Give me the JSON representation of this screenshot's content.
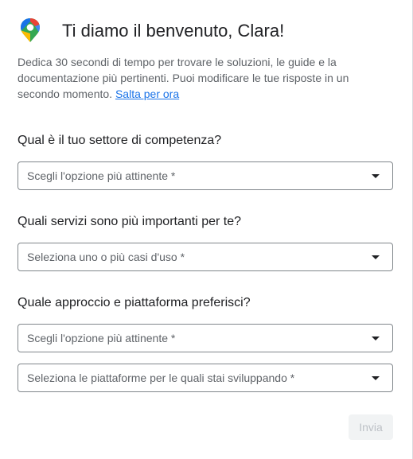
{
  "dialog": {
    "title": "Ti diamo il benvenuto, Clara!",
    "intro_text": "Dedica 30 secondi di tempo per trovare le soluzioni, le guide e la documentazione più pertinenti. Puoi modificare le tue risposte in un secondo momento.",
    "skip_link": "Salta per ora",
    "logo_icon": "google-maps-pin-icon"
  },
  "questions": [
    {
      "label": "Qual è il tuo settore di competenza?",
      "selects": [
        "Scegli l'opzione più attinente *"
      ]
    },
    {
      "label": "Quali servizi sono più importanti per te?",
      "selects": [
        "Seleziona uno o più casi d'uso *"
      ]
    },
    {
      "label": "Quale approccio e piattaforma preferisci?",
      "selects": [
        "Scegli l'opzione più attinente *",
        "Seleziona le piattaforme per le quali stai sviluppando *"
      ]
    }
  ],
  "submit_label": "Invia",
  "colors": {
    "link": "#1a73e8",
    "text_primary": "#202124",
    "text_secondary": "#5f6368",
    "button_disabled_bg": "#f1f3f4",
    "button_disabled_text": "#bdc1c6"
  }
}
